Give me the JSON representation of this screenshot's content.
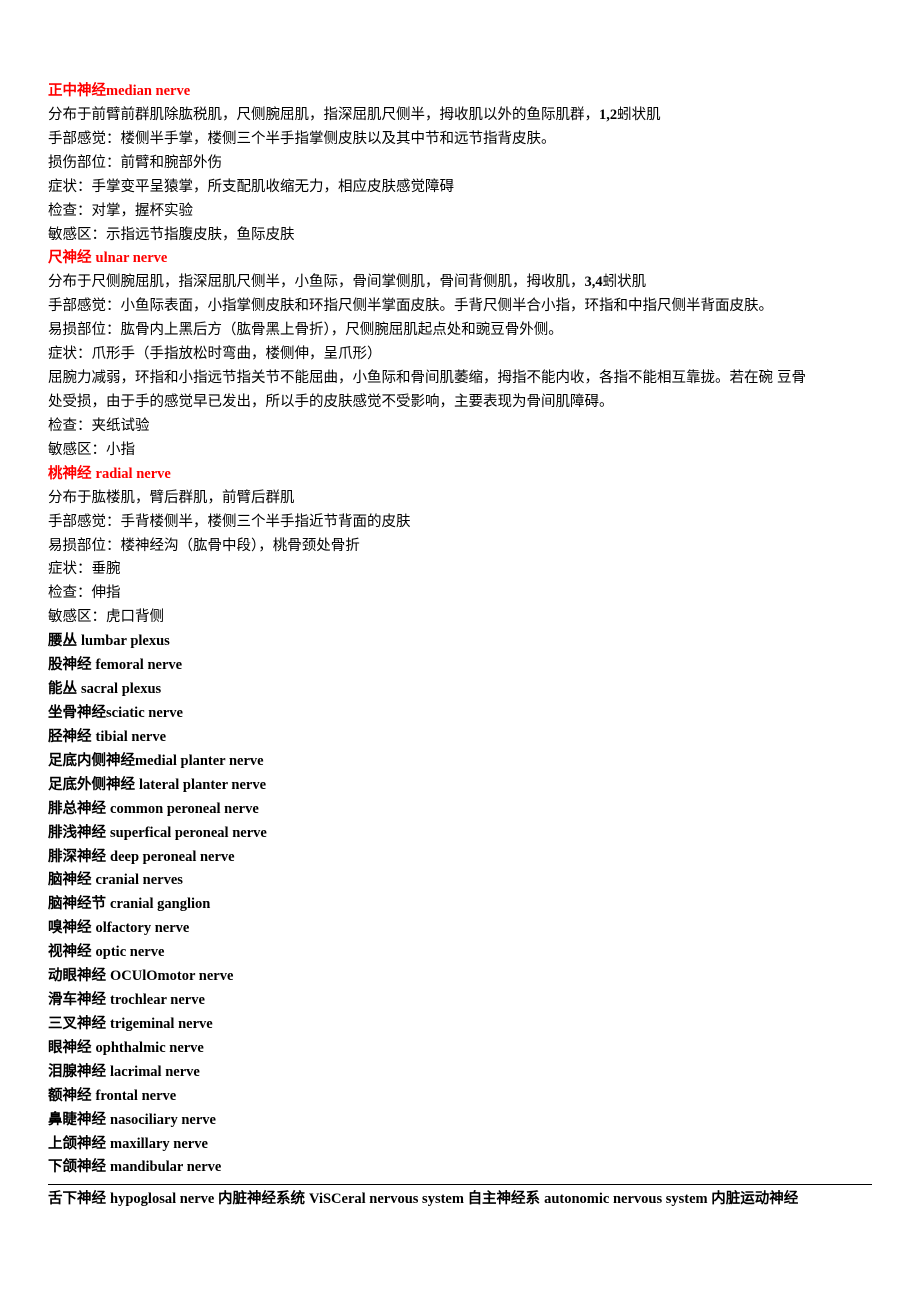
{
  "lines": [
    {
      "t": "median-nerve-title",
      "parts": [
        {
          "txt": "正中神经",
          "cls": "red bold"
        },
        {
          "txt": "median nerve",
          "cls": "red bold bold-latin"
        }
      ]
    },
    {
      "t": "median-dist",
      "parts": [
        {
          "txt": "分布于前臂前群肌除肱税肌，尺侧腕屈肌，指深屈肌尺侧半，拇收肌以外的鱼际肌群，"
        },
        {
          "txt": "1,2",
          "cls": "bold-latin"
        },
        {
          "txt": "蚓状肌"
        }
      ]
    },
    {
      "t": "median-sense",
      "parts": [
        {
          "txt": "手部感觉：楼侧半手掌，楼侧三个半手指掌侧皮肤以及其中节和远节指背皮肤。"
        }
      ]
    },
    {
      "t": "median-injury",
      "parts": [
        {
          "txt": "损伤部位：前臂和腕部外伤"
        }
      ]
    },
    {
      "t": "median-symptom",
      "parts": [
        {
          "txt": "症状：手掌变平呈猿掌，所支配肌收缩无力，相应皮肤感觉障碍"
        }
      ]
    },
    {
      "t": "median-exam",
      "parts": [
        {
          "txt": "检查：对掌，握杯实验"
        }
      ]
    },
    {
      "t": "median-area",
      "parts": [
        {
          "txt": "敏感区：示指远节指腹皮肤，鱼际皮肤"
        }
      ]
    },
    {
      "t": "ulnar-nerve-title",
      "parts": [
        {
          "txt": "尺神经 ",
          "cls": "red bold"
        },
        {
          "txt": "ulnar nerve",
          "cls": "red bold bold-latin"
        }
      ]
    },
    {
      "t": "ulnar-dist",
      "parts": [
        {
          "txt": "分布于尺侧腕屈肌，指深屈肌尺侧半，小鱼际，骨间掌侧肌，骨间背侧肌，拇收肌，"
        },
        {
          "txt": "3,4",
          "cls": "bold-latin"
        },
        {
          "txt": "蚓状肌"
        }
      ]
    },
    {
      "t": "ulnar-sense",
      "parts": [
        {
          "txt": "手部感觉：小鱼际表面，小指掌侧皮肤和环指尺侧半掌面皮肤。手背尺侧半合小指，环指和中指尺侧半背面皮肤。"
        }
      ]
    },
    {
      "t": "ulnar-injury",
      "parts": [
        {
          "txt": "易损部位：肱骨内上黑后方（肱骨黑上骨折），尺侧腕屈肌起点处和豌豆骨外侧。"
        }
      ]
    },
    {
      "t": "ulnar-symptom",
      "parts": [
        {
          "txt": "症状：爪形手（手指放松时弯曲，楼侧伸，呈爪形）"
        }
      ]
    },
    {
      "t": "ulnar-desc1",
      "parts": [
        {
          "txt": "屈腕力减弱，环指和小指远节指关节不能屈曲，小鱼际和骨间肌萎缩，拇指不能内收，各指不能相互靠拢。若在碗 豆骨"
        }
      ]
    },
    {
      "t": "ulnar-desc2",
      "parts": [
        {
          "txt": "处受损，由于手的感觉早已发出，所以手的皮肤感觉不受影响，主要表现为骨间肌障碍。"
        }
      ]
    },
    {
      "t": "ulnar-exam",
      "parts": [
        {
          "txt": "检查：夹纸试验"
        }
      ]
    },
    {
      "t": "ulnar-area",
      "parts": [
        {
          "txt": "敏感区：小指"
        }
      ]
    },
    {
      "t": "radial-nerve-title",
      "parts": [
        {
          "txt": "桃神经 ",
          "cls": "red bold"
        },
        {
          "txt": "radial nerve",
          "cls": "red bold bold-latin"
        }
      ]
    },
    {
      "t": "radial-dist",
      "parts": [
        {
          "txt": "分布于肱楼肌，臂后群肌，前臂后群肌"
        }
      ]
    },
    {
      "t": "radial-sense",
      "parts": [
        {
          "txt": "手部感觉：手背楼侧半，楼侧三个半手指近节背面的皮肤"
        }
      ]
    },
    {
      "t": "radial-injury",
      "parts": [
        {
          "txt": "易损部位：楼神经沟（肱骨中段），桃骨颈处骨折"
        }
      ]
    },
    {
      "t": "radial-symptom",
      "parts": [
        {
          "txt": "症状：垂腕"
        }
      ]
    },
    {
      "t": "radial-exam",
      "parts": [
        {
          "txt": "检查：伸指"
        }
      ]
    },
    {
      "t": "radial-area",
      "parts": [
        {
          "txt": "敏感区：虎口背侧"
        }
      ]
    },
    {
      "t": "lumbar-plexus",
      "parts": [
        {
          "txt": "腰丛 ",
          "cls": "bold"
        },
        {
          "txt": "lumbar plexus",
          "cls": "bold bold-latin"
        }
      ]
    },
    {
      "t": "femoral-nerve",
      "parts": [
        {
          "txt": "股神经 ",
          "cls": "bold"
        },
        {
          "txt": "femoral nerve",
          "cls": "bold bold-latin"
        }
      ]
    },
    {
      "t": "sacral-plexus",
      "parts": [
        {
          "txt": "能丛 ",
          "cls": "bold"
        },
        {
          "txt": "sacral plexus",
          "cls": "bold bold-latin"
        }
      ]
    },
    {
      "t": "sciatic-nerve",
      "parts": [
        {
          "txt": "坐骨神经",
          "cls": "bold"
        },
        {
          "txt": "sciatic nerve",
          "cls": "bold bold-latin"
        }
      ]
    },
    {
      "t": "tibial-nerve",
      "parts": [
        {
          "txt": "胫神经 ",
          "cls": "bold"
        },
        {
          "txt": "tibial nerve",
          "cls": "bold bold-latin"
        }
      ]
    },
    {
      "t": "medial-planter",
      "parts": [
        {
          "txt": "足底内侧神经",
          "cls": "bold"
        },
        {
          "txt": "medial planter nerve",
          "cls": "bold bold-latin"
        }
      ]
    },
    {
      "t": "lateral-planter",
      "parts": [
        {
          "txt": "足底外侧神经 ",
          "cls": "bold"
        },
        {
          "txt": "lateral planter nerve",
          "cls": "bold bold-latin"
        }
      ]
    },
    {
      "t": "common-peroneal",
      "parts": [
        {
          "txt": "腓总神经 ",
          "cls": "bold"
        },
        {
          "txt": "common peroneal nerve",
          "cls": "bold bold-latin"
        }
      ]
    },
    {
      "t": "superficial-peroneal",
      "parts": [
        {
          "txt": "腓浅神经 ",
          "cls": "bold"
        },
        {
          "txt": "superfical peroneal nerve",
          "cls": "bold bold-latin"
        }
      ]
    },
    {
      "t": "deep-peroneal",
      "parts": [
        {
          "txt": "腓深神经 ",
          "cls": "bold"
        },
        {
          "txt": "deep peroneal nerve",
          "cls": "bold bold-latin"
        }
      ]
    },
    {
      "t": "cranial-nerves",
      "parts": [
        {
          "txt": "脑神经 ",
          "cls": "bold"
        },
        {
          "txt": "cranial nerves",
          "cls": "bold bold-latin"
        }
      ]
    },
    {
      "t": "cranial-ganglion",
      "parts": [
        {
          "txt": "脑神经节 ",
          "cls": "bold"
        },
        {
          "txt": "cranial ganglion",
          "cls": "bold bold-latin"
        }
      ]
    },
    {
      "t": "olfactory-nerve",
      "parts": [
        {
          "txt": "嗅神经 ",
          "cls": "bold"
        },
        {
          "txt": "olfactory nerve",
          "cls": "bold bold-latin"
        }
      ]
    },
    {
      "t": "optic-nerve",
      "parts": [
        {
          "txt": "视神经 ",
          "cls": "bold"
        },
        {
          "txt": "optic nerve",
          "cls": "bold bold-latin"
        }
      ]
    },
    {
      "t": "oculomotor-nerve",
      "parts": [
        {
          "txt": "动眼神经 ",
          "cls": "bold"
        },
        {
          "txt": "OCUlOmotor nerve",
          "cls": "bold bold-latin"
        }
      ]
    },
    {
      "t": "trochlear-nerve",
      "parts": [
        {
          "txt": "滑车神经 ",
          "cls": "bold"
        },
        {
          "txt": "trochlear nerve",
          "cls": "bold bold-latin"
        }
      ]
    },
    {
      "t": "trigeminal-nerve",
      "parts": [
        {
          "txt": "三叉神经 ",
          "cls": "bold"
        },
        {
          "txt": "trigeminal nerve",
          "cls": "bold bold-latin"
        }
      ]
    },
    {
      "t": "ophthalmic-nerve",
      "parts": [
        {
          "txt": "眼神经 ",
          "cls": "bold"
        },
        {
          "txt": "ophthalmic nerve",
          "cls": "bold bold-latin"
        }
      ]
    },
    {
      "t": "lacrimal-nerve",
      "parts": [
        {
          "txt": "泪腺神经 ",
          "cls": "bold"
        },
        {
          "txt": "lacrimal nerve",
          "cls": "bold bold-latin"
        }
      ]
    },
    {
      "t": "frontal-nerve",
      "parts": [
        {
          "txt": "额神经 ",
          "cls": "bold"
        },
        {
          "txt": "frontal nerve",
          "cls": "bold bold-latin"
        }
      ]
    },
    {
      "t": "nasociliary-nerve",
      "parts": [
        {
          "txt": "鼻睫神经 ",
          "cls": "bold"
        },
        {
          "txt": "nasociliary nerve",
          "cls": "bold bold-latin"
        }
      ]
    },
    {
      "t": "maxillary-nerve",
      "parts": [
        {
          "txt": "上颌神经 ",
          "cls": "bold"
        },
        {
          "txt": "maxillary nerve",
          "cls": "bold bold-latin"
        }
      ]
    },
    {
      "t": "mandibular-nerve",
      "parts": [
        {
          "txt": "下颌神经 ",
          "cls": "bold"
        },
        {
          "txt": "mandibular nerve",
          "cls": "bold bold-latin"
        }
      ]
    }
  ],
  "footer": {
    "t": "footer-line",
    "parts": [
      {
        "txt": "舌下神经 ",
        "cls": "bold"
      },
      {
        "txt": "hypoglosal nerve ",
        "cls": "bold bold-latin"
      },
      {
        "txt": "内脏神经系统 ",
        "cls": "bold"
      },
      {
        "txt": "ViSCeral nervous system ",
        "cls": "bold bold-latin"
      },
      {
        "txt": "自主神经系 ",
        "cls": "bold"
      },
      {
        "txt": "autonomic nervous system ",
        "cls": "bold bold-latin"
      },
      {
        "txt": "内脏运动神经",
        "cls": "bold"
      }
    ]
  }
}
